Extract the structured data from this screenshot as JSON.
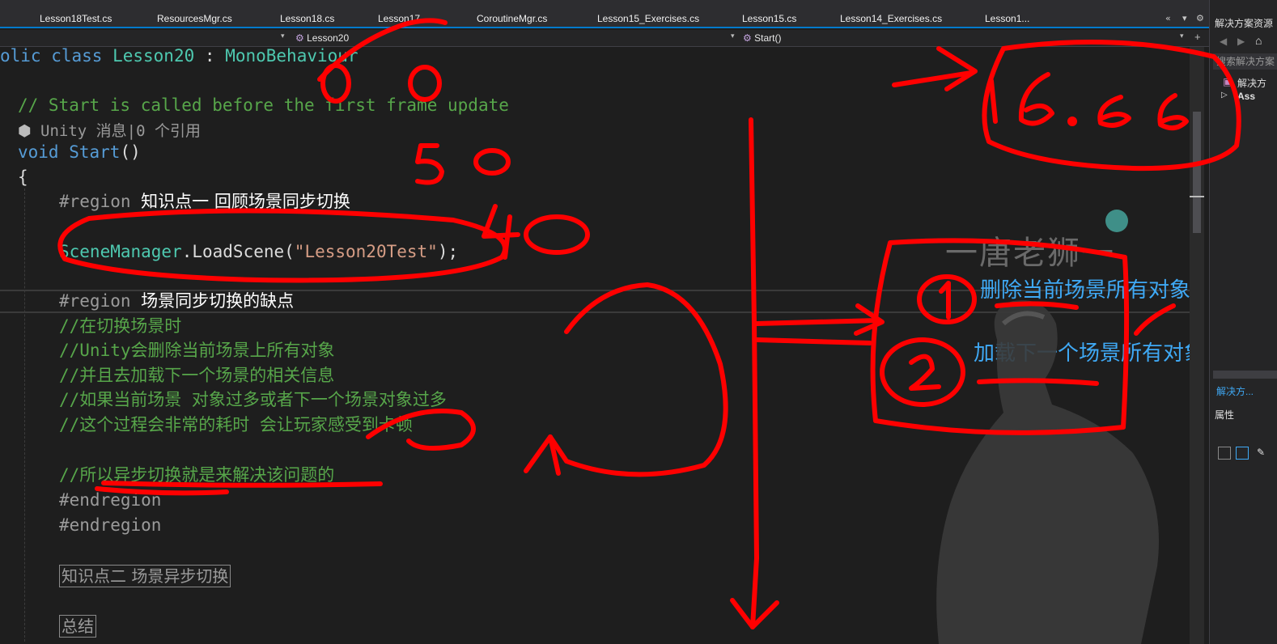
{
  "tabs": [
    "Lesson18Test.cs",
    "ResourcesMgr.cs",
    "Lesson18.cs",
    "Lesson17...",
    "CoroutineMgr.cs",
    "Lesson15_Exercises.cs",
    "Lesson15.cs",
    "Lesson14_Exercises.cs",
    "Lesson1..."
  ],
  "tab_controls": {
    "overflow": "«",
    "dropdown": "▾",
    "settings": "⚙"
  },
  "navbar": {
    "class_member": "Lesson20",
    "method_member": "Start()"
  },
  "code": {
    "line_class": {
      "prefix": "olic ",
      "kw_class": "class",
      "name": "Lesson20",
      "colon": " : ",
      "base": "MonoBehaviour"
    },
    "comment_start": "// Start is called before the first frame update",
    "codelens": "Unity 消息|0 个引用",
    "void_kw": "void",
    "method": "Start",
    "parens": "()",
    "brace": "{",
    "region1_kw": "#region",
    "region1_title": "知识点一 回顾场景同步切换",
    "scenemanager": "SceneManager",
    "loadscene": ".LoadScene(",
    "scene_string": "\"Lesson20Test\"",
    "call_end": ");",
    "region2_kw": "#region",
    "region2_title": "场景同步切换的缺点",
    "comments": [
      "//在切换场景时",
      "//Unity会删除当前场景上所有对象",
      "//并且去加载下一个场景的相关信息",
      "//如果当前场景 对象过多或者下一个场景对象过多",
      "//这个过程会非常的耗时 会让玩家感受到卡顿"
    ],
    "comment_last": "//所以异步切换就是来解决该问题的",
    "endregion1": "#endregion",
    "endregion2": "#endregion",
    "collapsed_1": "知识点二 场景异步切换",
    "collapsed_2": "总结"
  },
  "overlay": {
    "watermark": "一唐老狮一",
    "note_1": "删除当前场景所有对象",
    "note_2": "加载下一个场景所有对象"
  },
  "handwriting": {
    "fps": "16.66",
    "num_00": "0 0",
    "num_50": "50",
    "num_40": "40",
    "circle_1": "1",
    "circle_2": "2"
  },
  "right_panel": {
    "title": "解决方案资源",
    "search_placeholder": "搜索解决方案",
    "tree_item_1": "解决方",
    "tree_item_2": "Ass",
    "bottom_tab": "解决方...",
    "properties": "属性"
  },
  "colors": {
    "accent": "#007acc",
    "annotation": "#ff0000",
    "note_blue": "#3fa9f5"
  }
}
